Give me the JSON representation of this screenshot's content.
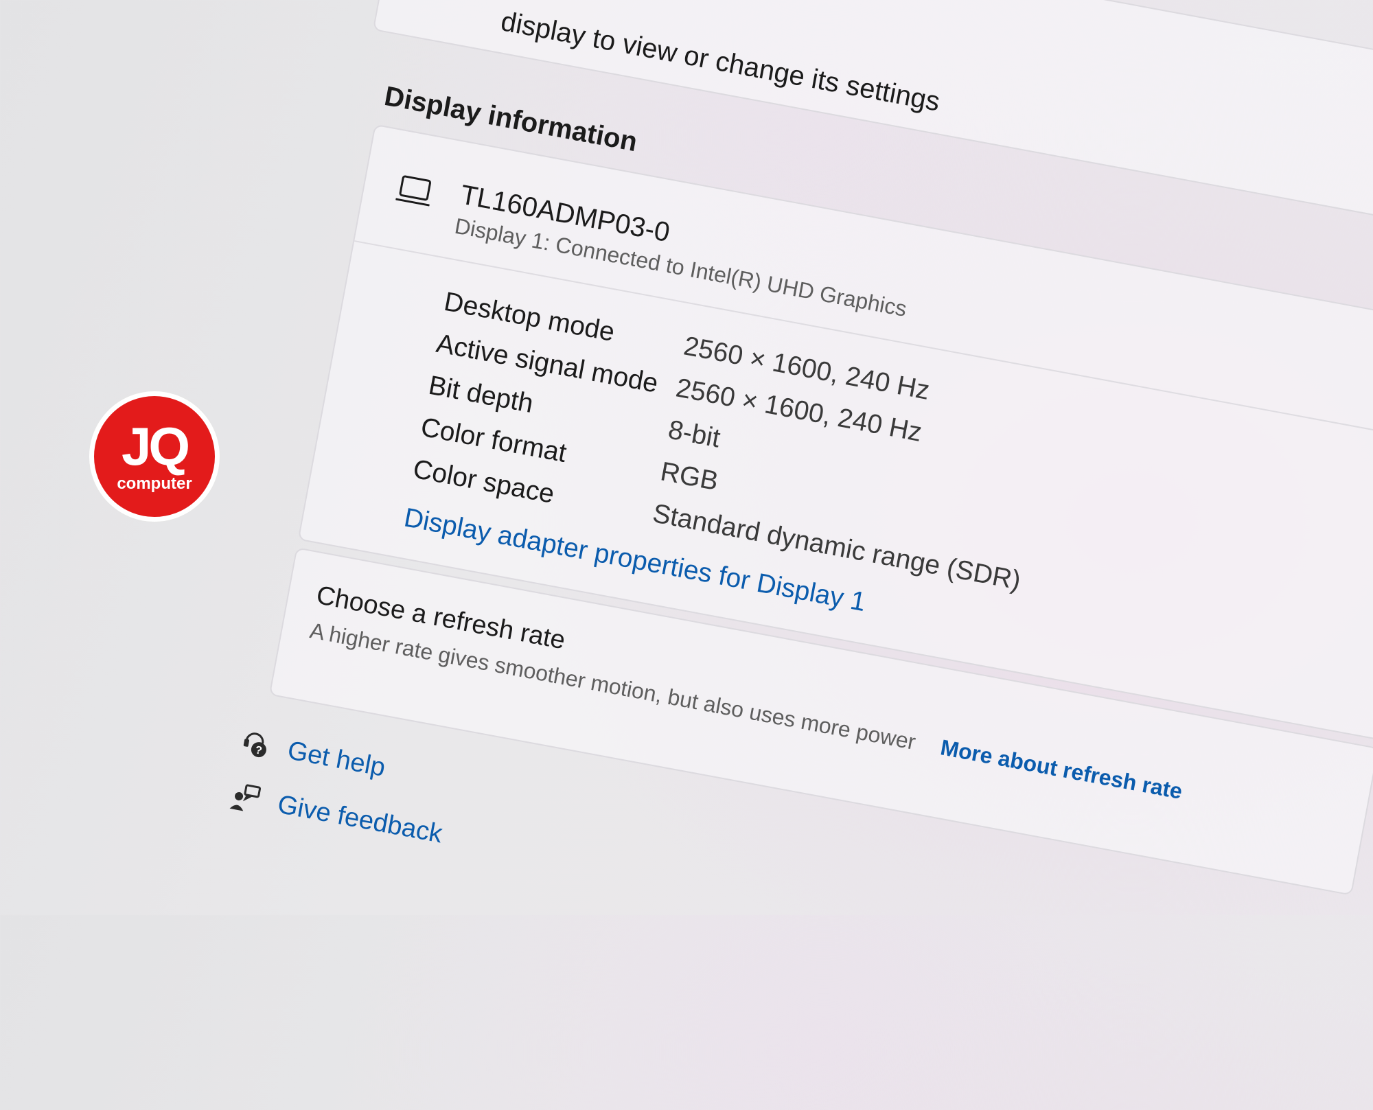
{
  "top_text": "display to view or change its settings",
  "section_title": "Display information",
  "monitor": {
    "name": "TL160ADMP03-0",
    "subtitle": "Display 1: Connected to Intel(R) UHD Graphics"
  },
  "specs": [
    {
      "label": "Desktop mode",
      "value": "2560 × 1600, 240 Hz"
    },
    {
      "label": "Active signal mode",
      "value": "2560 × 1600, 240 Hz"
    },
    {
      "label": "Bit depth",
      "value": "8-bit"
    },
    {
      "label": "Color format",
      "value": "RGB"
    },
    {
      "label": "Color space",
      "value": "Standard dynamic range (SDR)"
    }
  ],
  "adapter_link": "Display adapter properties for Display 1",
  "refresh": {
    "title": "Choose a refresh rate",
    "subtitle": "A higher rate gives smoother motion, but also uses more power",
    "link": "More about refresh rate"
  },
  "help": {
    "get_help": "Get help",
    "give_feedback": "Give feedback"
  },
  "logo": {
    "main": "JQ",
    "sub": "computer"
  },
  "colors": {
    "accent_link": "#0b5cad",
    "logo_red": "#e31b1b"
  }
}
